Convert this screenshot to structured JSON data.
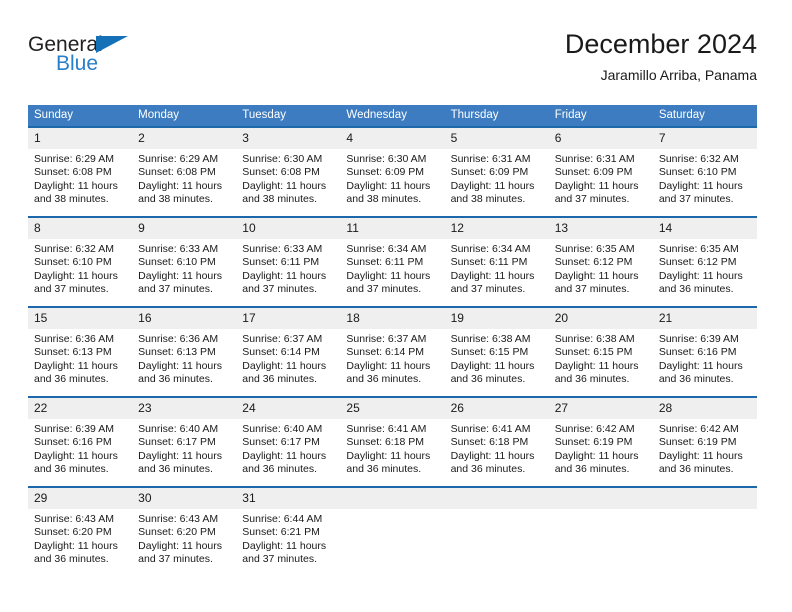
{
  "brand": {
    "name_top": "General",
    "name_bottom": "Blue",
    "triangle_color": "#1471b8",
    "blue_color": "#2a7fc9"
  },
  "header": {
    "title": "December 2024",
    "subtitle": "Jaramillo Arriba, Panama"
  },
  "theme": {
    "header_blue": "#3d7cc0",
    "row_border_blue": "#1c68ab",
    "daynum_bg": "#efefef"
  },
  "weekdays": [
    "Sunday",
    "Monday",
    "Tuesday",
    "Wednesday",
    "Thursday",
    "Friday",
    "Saturday"
  ],
  "weeks": [
    [
      {
        "day": "1",
        "sunrise": "Sunrise: 6:29 AM",
        "sunset": "Sunset: 6:08 PM",
        "daylight1": "Daylight: 11 hours",
        "daylight2": "and 38 minutes."
      },
      {
        "day": "2",
        "sunrise": "Sunrise: 6:29 AM",
        "sunset": "Sunset: 6:08 PM",
        "daylight1": "Daylight: 11 hours",
        "daylight2": "and 38 minutes."
      },
      {
        "day": "3",
        "sunrise": "Sunrise: 6:30 AM",
        "sunset": "Sunset: 6:08 PM",
        "daylight1": "Daylight: 11 hours",
        "daylight2": "and 38 minutes."
      },
      {
        "day": "4",
        "sunrise": "Sunrise: 6:30 AM",
        "sunset": "Sunset: 6:09 PM",
        "daylight1": "Daylight: 11 hours",
        "daylight2": "and 38 minutes."
      },
      {
        "day": "5",
        "sunrise": "Sunrise: 6:31 AM",
        "sunset": "Sunset: 6:09 PM",
        "daylight1": "Daylight: 11 hours",
        "daylight2": "and 38 minutes."
      },
      {
        "day": "6",
        "sunrise": "Sunrise: 6:31 AM",
        "sunset": "Sunset: 6:09 PM",
        "daylight1": "Daylight: 11 hours",
        "daylight2": "and 37 minutes."
      },
      {
        "day": "7",
        "sunrise": "Sunrise: 6:32 AM",
        "sunset": "Sunset: 6:10 PM",
        "daylight1": "Daylight: 11 hours",
        "daylight2": "and 37 minutes."
      }
    ],
    [
      {
        "day": "8",
        "sunrise": "Sunrise: 6:32 AM",
        "sunset": "Sunset: 6:10 PM",
        "daylight1": "Daylight: 11 hours",
        "daylight2": "and 37 minutes."
      },
      {
        "day": "9",
        "sunrise": "Sunrise: 6:33 AM",
        "sunset": "Sunset: 6:10 PM",
        "daylight1": "Daylight: 11 hours",
        "daylight2": "and 37 minutes."
      },
      {
        "day": "10",
        "sunrise": "Sunrise: 6:33 AM",
        "sunset": "Sunset: 6:11 PM",
        "daylight1": "Daylight: 11 hours",
        "daylight2": "and 37 minutes."
      },
      {
        "day": "11",
        "sunrise": "Sunrise: 6:34 AM",
        "sunset": "Sunset: 6:11 PM",
        "daylight1": "Daylight: 11 hours",
        "daylight2": "and 37 minutes."
      },
      {
        "day": "12",
        "sunrise": "Sunrise: 6:34 AM",
        "sunset": "Sunset: 6:11 PM",
        "daylight1": "Daylight: 11 hours",
        "daylight2": "and 37 minutes."
      },
      {
        "day": "13",
        "sunrise": "Sunrise: 6:35 AM",
        "sunset": "Sunset: 6:12 PM",
        "daylight1": "Daylight: 11 hours",
        "daylight2": "and 37 minutes."
      },
      {
        "day": "14",
        "sunrise": "Sunrise: 6:35 AM",
        "sunset": "Sunset: 6:12 PM",
        "daylight1": "Daylight: 11 hours",
        "daylight2": "and 36 minutes."
      }
    ],
    [
      {
        "day": "15",
        "sunrise": "Sunrise: 6:36 AM",
        "sunset": "Sunset: 6:13 PM",
        "daylight1": "Daylight: 11 hours",
        "daylight2": "and 36 minutes."
      },
      {
        "day": "16",
        "sunrise": "Sunrise: 6:36 AM",
        "sunset": "Sunset: 6:13 PM",
        "daylight1": "Daylight: 11 hours",
        "daylight2": "and 36 minutes."
      },
      {
        "day": "17",
        "sunrise": "Sunrise: 6:37 AM",
        "sunset": "Sunset: 6:14 PM",
        "daylight1": "Daylight: 11 hours",
        "daylight2": "and 36 minutes."
      },
      {
        "day": "18",
        "sunrise": "Sunrise: 6:37 AM",
        "sunset": "Sunset: 6:14 PM",
        "daylight1": "Daylight: 11 hours",
        "daylight2": "and 36 minutes."
      },
      {
        "day": "19",
        "sunrise": "Sunrise: 6:38 AM",
        "sunset": "Sunset: 6:15 PM",
        "daylight1": "Daylight: 11 hours",
        "daylight2": "and 36 minutes."
      },
      {
        "day": "20",
        "sunrise": "Sunrise: 6:38 AM",
        "sunset": "Sunset: 6:15 PM",
        "daylight1": "Daylight: 11 hours",
        "daylight2": "and 36 minutes."
      },
      {
        "day": "21",
        "sunrise": "Sunrise: 6:39 AM",
        "sunset": "Sunset: 6:16 PM",
        "daylight1": "Daylight: 11 hours",
        "daylight2": "and 36 minutes."
      }
    ],
    [
      {
        "day": "22",
        "sunrise": "Sunrise: 6:39 AM",
        "sunset": "Sunset: 6:16 PM",
        "daylight1": "Daylight: 11 hours",
        "daylight2": "and 36 minutes."
      },
      {
        "day": "23",
        "sunrise": "Sunrise: 6:40 AM",
        "sunset": "Sunset: 6:17 PM",
        "daylight1": "Daylight: 11 hours",
        "daylight2": "and 36 minutes."
      },
      {
        "day": "24",
        "sunrise": "Sunrise: 6:40 AM",
        "sunset": "Sunset: 6:17 PM",
        "daylight1": "Daylight: 11 hours",
        "daylight2": "and 36 minutes."
      },
      {
        "day": "25",
        "sunrise": "Sunrise: 6:41 AM",
        "sunset": "Sunset: 6:18 PM",
        "daylight1": "Daylight: 11 hours",
        "daylight2": "and 36 minutes."
      },
      {
        "day": "26",
        "sunrise": "Sunrise: 6:41 AM",
        "sunset": "Sunset: 6:18 PM",
        "daylight1": "Daylight: 11 hours",
        "daylight2": "and 36 minutes."
      },
      {
        "day": "27",
        "sunrise": "Sunrise: 6:42 AM",
        "sunset": "Sunset: 6:19 PM",
        "daylight1": "Daylight: 11 hours",
        "daylight2": "and 36 minutes."
      },
      {
        "day": "28",
        "sunrise": "Sunrise: 6:42 AM",
        "sunset": "Sunset: 6:19 PM",
        "daylight1": "Daylight: 11 hours",
        "daylight2": "and 36 minutes."
      }
    ],
    [
      {
        "day": "29",
        "sunrise": "Sunrise: 6:43 AM",
        "sunset": "Sunset: 6:20 PM",
        "daylight1": "Daylight: 11 hours",
        "daylight2": "and 36 minutes."
      },
      {
        "day": "30",
        "sunrise": "Sunrise: 6:43 AM",
        "sunset": "Sunset: 6:20 PM",
        "daylight1": "Daylight: 11 hours",
        "daylight2": "and 37 minutes."
      },
      {
        "day": "31",
        "sunrise": "Sunrise: 6:44 AM",
        "sunset": "Sunset: 6:21 PM",
        "daylight1": "Daylight: 11 hours",
        "daylight2": "and 37 minutes."
      },
      {
        "day": "",
        "sunrise": "",
        "sunset": "",
        "daylight1": "",
        "daylight2": ""
      },
      {
        "day": "",
        "sunrise": "",
        "sunset": "",
        "daylight1": "",
        "daylight2": ""
      },
      {
        "day": "",
        "sunrise": "",
        "sunset": "",
        "daylight1": "",
        "daylight2": ""
      },
      {
        "day": "",
        "sunrise": "",
        "sunset": "",
        "daylight1": "",
        "daylight2": ""
      }
    ]
  ]
}
